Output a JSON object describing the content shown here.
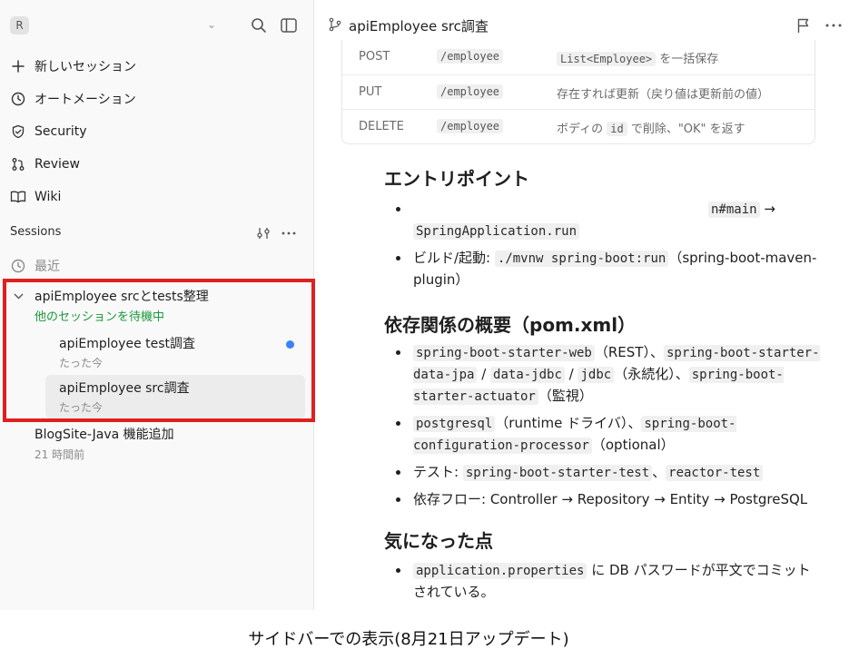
{
  "sidebar": {
    "workspace_initial": "R",
    "nav": {
      "new_session": "新しいセッション",
      "automation": "オートメーション",
      "security": "Security",
      "review": "Review",
      "wiki": "Wiki"
    },
    "sessions_label": "Sessions",
    "recent_label": "最近",
    "group": {
      "title": "apiEmployee srcとtests整理",
      "status": "他のセッションを待機中",
      "status_color": "#1a9a3c",
      "children": [
        {
          "title": "apiEmployee test調査",
          "time": "たった今",
          "unread": true
        },
        {
          "title": "apiEmployee src調査",
          "time": "たった今",
          "active": true
        }
      ]
    },
    "other_session": {
      "title": "BlogSite-Java 機能追加",
      "time": "21 時間前"
    }
  },
  "main": {
    "title": "apiEmployee src調査",
    "api_rows": [
      {
        "method": "POST",
        "path": "/employee",
        "desc_code": "List<Employee>",
        "desc_rest": " を一括保存"
      },
      {
        "method": "PUT",
        "path": "/employee",
        "desc_text": "存在すれば更新（戻り値は更新前の値）"
      },
      {
        "method": "DELETE",
        "path": "/employee",
        "desc_pre": "ボディの ",
        "desc_code": "id",
        "desc_rest": " で削除、\"OK\" を返す"
      }
    ],
    "entry": {
      "heading": "エントリポイント",
      "item1_code_a": "n#main",
      "item1_arrow": " →",
      "item1_code_b": "SpringApplication.run",
      "item2_text": "ビルド/起動: ",
      "item2_code": "./mvnw spring-boot:run",
      "item2_rest": "（spring-boot-maven-plugin）"
    },
    "deps": {
      "heading": "依存関係の概要（pom.xml）",
      "d1_c1": "spring-boot-starter-web",
      "d1_t1": "（REST）、",
      "d1_c2": "spring-boot-starter-data-jpa",
      "d1_t2": " / ",
      "d1_c3": "data-jdbc",
      "d1_t3": " / ",
      "d1_c4": "jdbc",
      "d1_t4": "（永続化）、",
      "d1_c5": "spring-boot-starter-actuator",
      "d1_t5": "（監視）",
      "d2_c1": "postgresql",
      "d2_t1": "（runtime ドライバ）、",
      "d2_c2": "spring-boot-configuration-processor",
      "d2_t2": "（optional）",
      "d3_t0": "テスト: ",
      "d3_c1": "spring-boot-starter-test",
      "d3_t1": "、",
      "d3_c2": "reactor-test",
      "d4_t0": "依存フロー: Controller → Repository → Entity → PostgreSQL"
    },
    "notes": {
      "heading": "気になった点",
      "n1_code": "application.properties",
      "n1_text": " に DB パスワードが平文でコミットされている。"
    }
  },
  "caption": "サイドバーでの表示(8月21日アップデート)"
}
